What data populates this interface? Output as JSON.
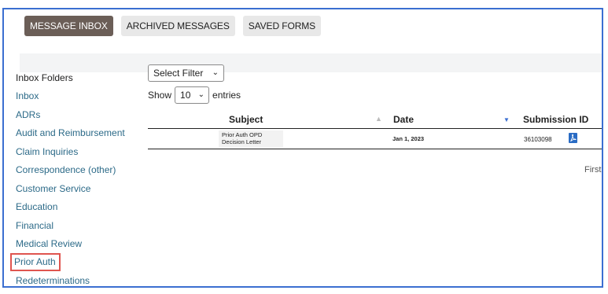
{
  "tabs": [
    {
      "label": "MESSAGE INBOX",
      "active": true
    },
    {
      "label": "ARCHIVED MESSAGES",
      "active": false
    },
    {
      "label": "SAVED FORMS",
      "active": false
    }
  ],
  "sidebar": {
    "title": "Inbox Folders",
    "items": [
      {
        "label": "Inbox"
      },
      {
        "label": "ADRs"
      },
      {
        "label": "Audit and Reimbursement"
      },
      {
        "label": "Claim Inquiries"
      },
      {
        "label": "Correspondence (other)"
      },
      {
        "label": "Customer Service"
      },
      {
        "label": "Education"
      },
      {
        "label": "Financial"
      },
      {
        "label": "Medical Review"
      },
      {
        "label": "Prior Auth",
        "highlighted": true
      },
      {
        "label": "Redeterminations"
      }
    ]
  },
  "filter": {
    "selected": "Select Filter"
  },
  "entries": {
    "prefix": "Show",
    "value": "10",
    "suffix": "entries"
  },
  "table": {
    "columns": [
      "Subject",
      "Date",
      "Submission ID"
    ],
    "rows": [
      {
        "subject": "Prior Auth OPD Decision Letter",
        "date": "Jan 1, 2023",
        "submission_id": "36103098",
        "icon": "pdf-icon"
      }
    ]
  },
  "pagination": {
    "first_label": "First"
  },
  "colors": {
    "frame": "#3b6fd1",
    "active_tab": "#6b5e57",
    "link": "#2c6a88",
    "highlight": "#e0554f",
    "pdf": "#2a6cc4"
  }
}
